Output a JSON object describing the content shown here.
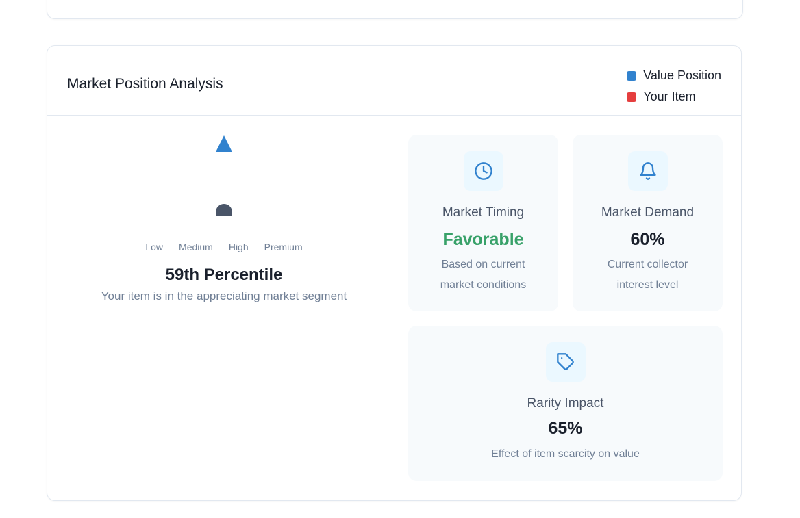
{
  "section": {
    "title": "Market Position Analysis",
    "legend": [
      {
        "label": "Value Position",
        "color": "#3182ce"
      },
      {
        "label": "Your Item",
        "color": "#e53e3e"
      }
    ]
  },
  "gauge": {
    "scale_labels": [
      "Low",
      "Medium",
      "High",
      "Premium"
    ],
    "percentile_label": "59th Percentile",
    "subtitle": "Your item is in the appreciating market segment"
  },
  "metrics": {
    "timing": {
      "icon": "clock-icon",
      "title": "Market Timing",
      "value": "Favorable",
      "value_color": "#38a169",
      "desc": "Based on current market conditions"
    },
    "demand": {
      "icon": "bell-icon",
      "title": "Market Demand",
      "value": "60%",
      "desc": "Current collector interest level"
    },
    "rarity": {
      "icon": "tag-icon",
      "title": "Rarity Impact",
      "value": "65%",
      "desc": "Effect of item scarcity on value"
    }
  }
}
